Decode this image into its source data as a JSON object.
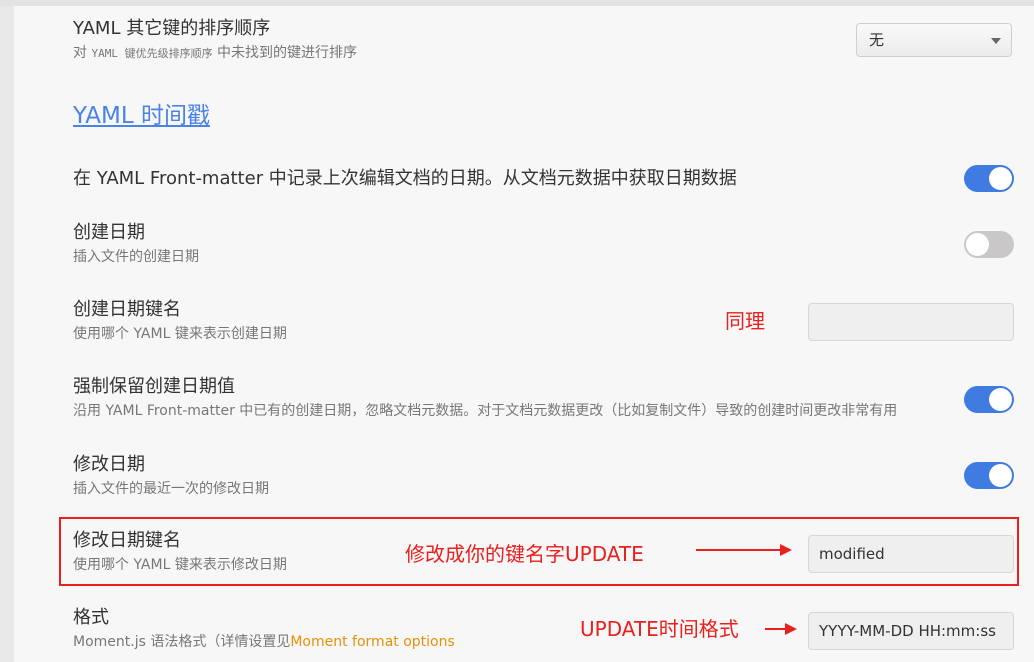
{
  "sort_other_keys": {
    "title": "YAML 其它键的排序顺序",
    "desc_prefix": "对",
    "desc_code": "YAML 键优先级排序顺序",
    "desc_suffix": "中未找到的键进行排序",
    "select_value": "无"
  },
  "section": {
    "heading": "YAML 时间戳"
  },
  "record_last_edit": {
    "title": "在 YAML Front-matter 中记录上次编辑文档的日期。从文档元数据中获取日期数据",
    "enabled": true
  },
  "created_date": {
    "title": "创建日期",
    "desc": "插入文件的创建日期",
    "enabled": false
  },
  "created_key": {
    "title": "创建日期键名",
    "desc": "使用哪个 YAML 键来表示创建日期",
    "value": ""
  },
  "keep_created": {
    "title": "强制保留创建日期值",
    "desc": "沿用 YAML Front-matter 中已有的创建日期，忽略文档元数据。对于文档元数据更改（比如复制文件）导致的创建时间更改非常有用",
    "enabled": true
  },
  "modified_date": {
    "title": "修改日期",
    "desc": "插入文件的最近一次的修改日期",
    "enabled": true
  },
  "modified_key": {
    "title": "修改日期键名",
    "desc": "使用哪个 YAML 键来表示修改日期",
    "value": "modified"
  },
  "format": {
    "title": "格式",
    "desc_prefix": "Moment.js 语法格式（详情设置见",
    "desc_link": "Moment format options",
    "value": "YYYY-MM-DD HH:mm:ss"
  },
  "annotations": {
    "same": "同理",
    "rename_key": "修改成你的键名字UPDATE",
    "time_format": "UPDATE时间格式",
    "color": "#e8201e"
  },
  "colors": {
    "accent": "#3f7be1",
    "link": "#e8900a",
    "heading": "#4a83e6"
  }
}
